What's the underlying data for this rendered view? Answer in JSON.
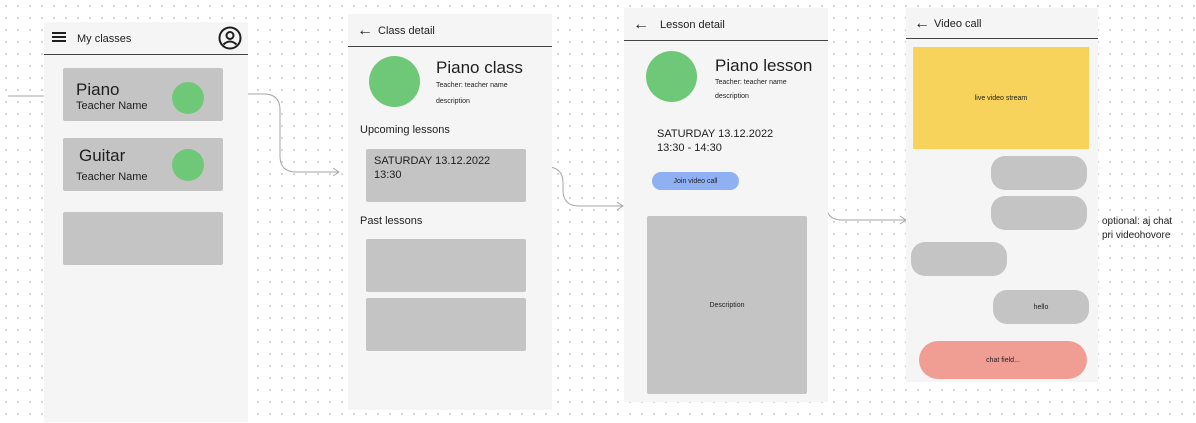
{
  "my_classes": {
    "title": "My classes",
    "classes": [
      {
        "name": "Piano",
        "teacher": "Teacher Name"
      },
      {
        "name": "Guitar",
        "teacher": "Teacher Name"
      }
    ]
  },
  "class_detail": {
    "title": "Class detail",
    "class_name": "Piano class",
    "teacher": "Teacher: teacher name",
    "description": "description",
    "upcoming_heading": "Upcoming lessons",
    "upcoming_date": "SATURDAY 13.12.2022",
    "upcoming_time": "13:30",
    "past_heading": "Past lessons"
  },
  "lesson_detail": {
    "title": "Lesson detail",
    "lesson_name": "Piano lesson",
    "teacher": "Teacher: teacher name",
    "description": "description",
    "date": "SATURDAY 13.12.2022",
    "time": "13:30 - 14:30",
    "join_label": "Join video call",
    "description_box": "Description"
  },
  "video_call": {
    "title": "Video call",
    "stream_label": "live video stream",
    "message_hello": "hello",
    "chat_placeholder": "chat field..."
  },
  "note": {
    "line1": "optional: aj chat",
    "line2": "pri videohovore"
  },
  "colors": {
    "frame": "#f5f5f5",
    "card": "#c4c4c4",
    "avatar": "#6fc877",
    "join_button": "#8fb0f2",
    "video_stream": "#f7d35b",
    "chat_field": "#f09e94",
    "bubble": "#c4c4c4"
  }
}
